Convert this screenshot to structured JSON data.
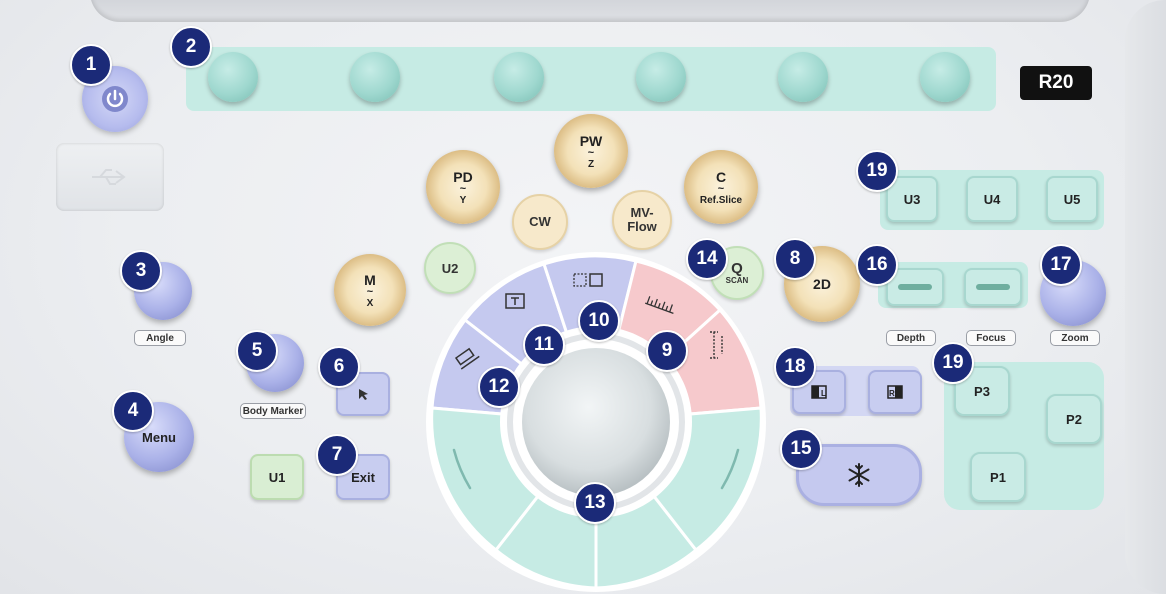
{
  "model_badge": "R20",
  "callouts": [
    "1",
    "2",
    "3",
    "4",
    "5",
    "6",
    "7",
    "8",
    "9",
    "10",
    "11",
    "12",
    "13",
    "14",
    "15",
    "16",
    "17",
    "18",
    "19",
    "19"
  ],
  "knobs": {
    "pw": {
      "label": "PW",
      "sub": "Z"
    },
    "pd": {
      "label": "PD",
      "sub": "Y"
    },
    "c": {
      "label": "C",
      "sub": "Ref.Slice"
    },
    "m": {
      "label": "M",
      "sub": "X"
    },
    "two_d": {
      "label": "2D"
    }
  },
  "buttons": {
    "cw": "CW",
    "mv_flow_1": "MV-",
    "mv_flow_2": "Flow",
    "u2": "U2",
    "q": "Q",
    "q_sub": "SCAN",
    "u3": "U3",
    "u4": "U4",
    "u5": "U5",
    "menu": "Menu",
    "u1": "U1",
    "exit": "Exit",
    "p1": "P1",
    "p2": "P2",
    "p3": "P3"
  },
  "labels": {
    "angle": "Angle",
    "body_marker": "Body Marker",
    "depth": "Depth",
    "focus": "Focus",
    "zoom": "Zoom"
  },
  "icons": [
    "power-icon",
    "usb-icon",
    "cursor-arrow-icon",
    "text-icon",
    "dual-view-icon",
    "ruler-icon",
    "caliper-icon",
    "eraser-icon",
    "l-view-icon",
    "r-view-icon",
    "snowflake-icon"
  ],
  "colors": {
    "badge_navy": "#1b2a78",
    "teal_zone": "#c6ebe4",
    "lavender_zone": "#d3d7f3",
    "pink_segment": "#f6c9cc",
    "gold_knob": "#f3e1b8"
  }
}
